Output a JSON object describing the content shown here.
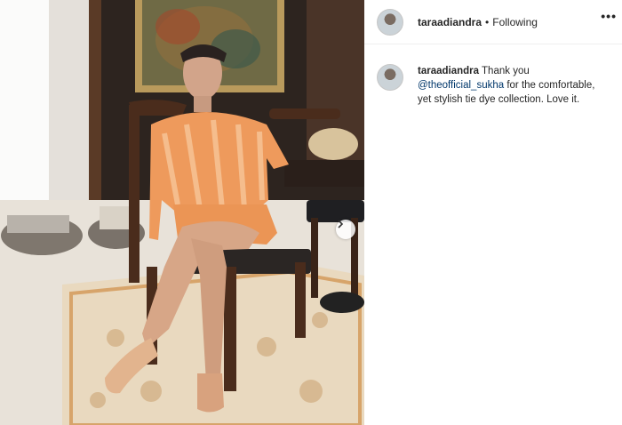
{
  "header": {
    "username": "taraadiandra",
    "separator": "•",
    "follow_status": "Following",
    "more_icon": "more-horizontal-icon",
    "more_label": "•••"
  },
  "caption": {
    "username": "taraadiandra",
    "text_before": "Thank you",
    "mention": "@theofficial_sukha",
    "text_after": "for the comfortable, yet stylish tie dye collection. Love it."
  },
  "carousel": {
    "next_icon": "chevron-right-icon"
  },
  "colors": {
    "link": "#00376b",
    "text": "#262626",
    "divider": "#efefef"
  }
}
